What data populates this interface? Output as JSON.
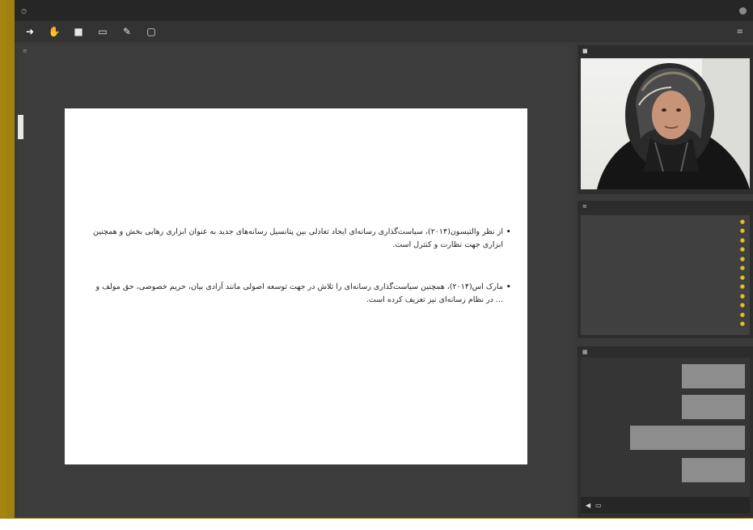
{
  "titlebar": {
    "app_name": "",
    "meeting_title": "",
    "clock_glyph": "◷",
    "user_icon": "avatar"
  },
  "toolbar": {
    "tools": [
      {
        "name": "share-icon",
        "glyph": "➜"
      },
      {
        "name": "hand-icon",
        "glyph": "✋"
      },
      {
        "name": "camera-icon",
        "glyph": "■"
      },
      {
        "name": "screen-icon",
        "glyph": "▭"
      },
      {
        "name": "pen-icon",
        "glyph": "✎"
      },
      {
        "name": "whiteboard-icon",
        "glyph": "▢"
      }
    ],
    "menu_glyph": "≡"
  },
  "content": {
    "doc_name": ""
  },
  "slide": {
    "bullets": [
      "از نظر والتیسون(۲۰۱۴)، سیاست‌گذاری رسانه‌ای ایجاد تعادلی بین پتانسیل رسانه‌های جدید به عنوان ابزاری رهایی بخش و همچنین ابزاری جهت نظارت و کنترل است.",
      "مارک اس(۲۰۱۴)، همچنین سیاست‌گذاری رسانه‌ای را تلاش در جهت توسعه اصولی مانند آزادی بیان، حریم خصوصی، حق مولف و ... در نظام رسانه‌ای نیز تعریف کرده است."
    ]
  },
  "video": {
    "header": ""
  },
  "attendees": {
    "header": "",
    "items": [
      "",
      "",
      "",
      "",
      "",
      "",
      "",
      "",
      "",
      "",
      "",
      ""
    ]
  },
  "chat": {
    "messages": [
      {
        "sender": "",
        "text": ""
      },
      {
        "sender": "",
        "text": ""
      },
      {
        "sender": "",
        "text": ""
      },
      {
        "sender": "",
        "text": ""
      }
    ],
    "input_placeholder": ""
  },
  "colors": {
    "frame": "#a58512",
    "app_bg": "#3a3a3a",
    "attendee_icon": "#e0c020"
  }
}
